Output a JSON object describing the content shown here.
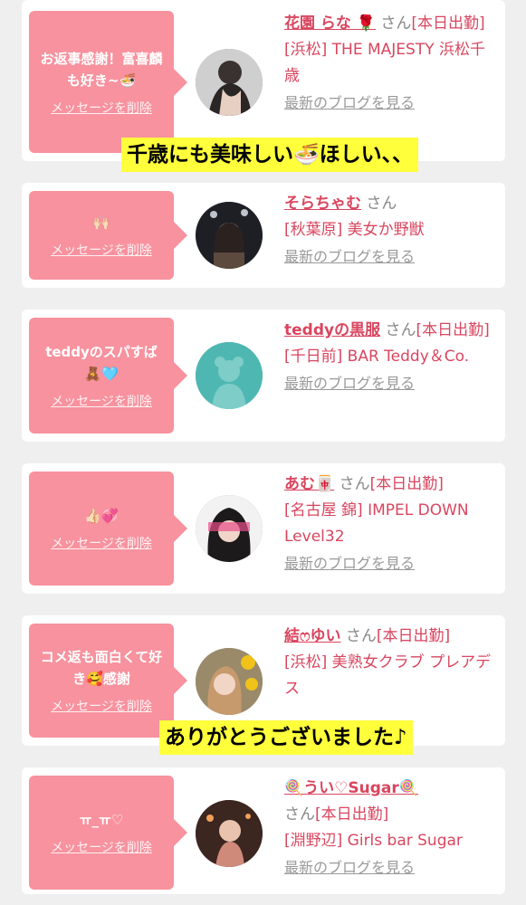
{
  "list": [
    {
      "message": "お返事感謝！富喜麟も好き~🍜",
      "delete_label": "メッセージを削除",
      "name": "花園 らな 🌹",
      "san": "さん",
      "status": "[本日出勤]",
      "shop": "[浜松] THE MAJESTY 浜松千歳",
      "blog_link": "最新のブログを見る"
    },
    {
      "message": "🙌🏻",
      "delete_label": "メッセージを削除",
      "name": "そらちゃむ",
      "san": "さん",
      "status": "",
      "shop": "[秋葉原] 美女か野獣",
      "blog_link": "最新のブログを見る"
    },
    {
      "message": "teddyのスパすば🧸🩵",
      "delete_label": "メッセージを削除",
      "name": "teddyの黒服",
      "san": "さん",
      "status": "[本日出勤]",
      "shop": "[千日前] BAR Teddy＆Co.",
      "blog_link": "最新のブログを見る"
    },
    {
      "message": "👍🏻💞",
      "delete_label": "メッセージを削除",
      "name": "あむ🀄",
      "san": "さん",
      "status": "[本日出勤]",
      "shop": "[名古屋 錦] IMPEL DOWN Level32",
      "blog_link": "最新のブログを見る"
    },
    {
      "message": "コメ返も面白くて好き🥰感謝",
      "delete_label": "メッセージを削除",
      "name": "結ෆゆい",
      "san": "さん",
      "status": "[本日出勤]",
      "shop": "[浜松] 美熟女クラブ プレアデス",
      "blog_link": ""
    },
    {
      "message": "ㅠ_ㅠ♡",
      "delete_label": "メッセージを削除",
      "name": "🍭うい♡Sugar🍭",
      "san": "さん",
      "status": "[本日出勤]",
      "shop": "[淵野辺] Girls bar Sugar",
      "blog_link": "最新のブログを見る"
    }
  ],
  "captions": {
    "top": "千歳にも美味しい🍜ほしい、、",
    "bottom": "ありがとうございました♪"
  },
  "colors": {
    "background": "#efefef",
    "bubble": "#f7929e",
    "name": "#d9465f",
    "caption_bg": "#ffff3c"
  }
}
